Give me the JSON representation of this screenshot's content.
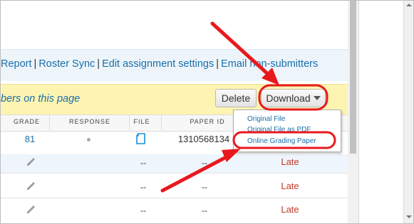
{
  "links": {
    "report": "Report",
    "roster_sync": "Roster Sync",
    "edit_settings": "Edit assignment settings",
    "email_nonsubmitters": "Email non-submitters",
    "separator": "|"
  },
  "action_bar": {
    "page_link_text": "bers on this page",
    "delete_label": "Delete",
    "download_label": "Download"
  },
  "table": {
    "headers": [
      "GRADE",
      "RESPONSE",
      "FILE",
      "PAPER ID"
    ],
    "rows": [
      {
        "grade": "81",
        "paper_id": "1310568134",
        "status": ""
      },
      {
        "grade": "",
        "file": "--",
        "paper_id": "--",
        "status": "Late"
      },
      {
        "grade": "",
        "file": "--",
        "paper_id": "--",
        "status": "Late"
      },
      {
        "grade": "",
        "file": "--",
        "paper_id": "--",
        "status": "Late"
      }
    ]
  },
  "download_menu": {
    "items": [
      "Original File",
      "Original File as PDF",
      "Online Grading Paper"
    ]
  },
  "colors": {
    "link": "#1a6ea8",
    "late": "#c0392b",
    "highlight_bar": "#fdf4b1",
    "annotation_red": "#e8191e"
  },
  "icons": [
    "pencil-icon",
    "file-icon",
    "caret-down-icon"
  ]
}
